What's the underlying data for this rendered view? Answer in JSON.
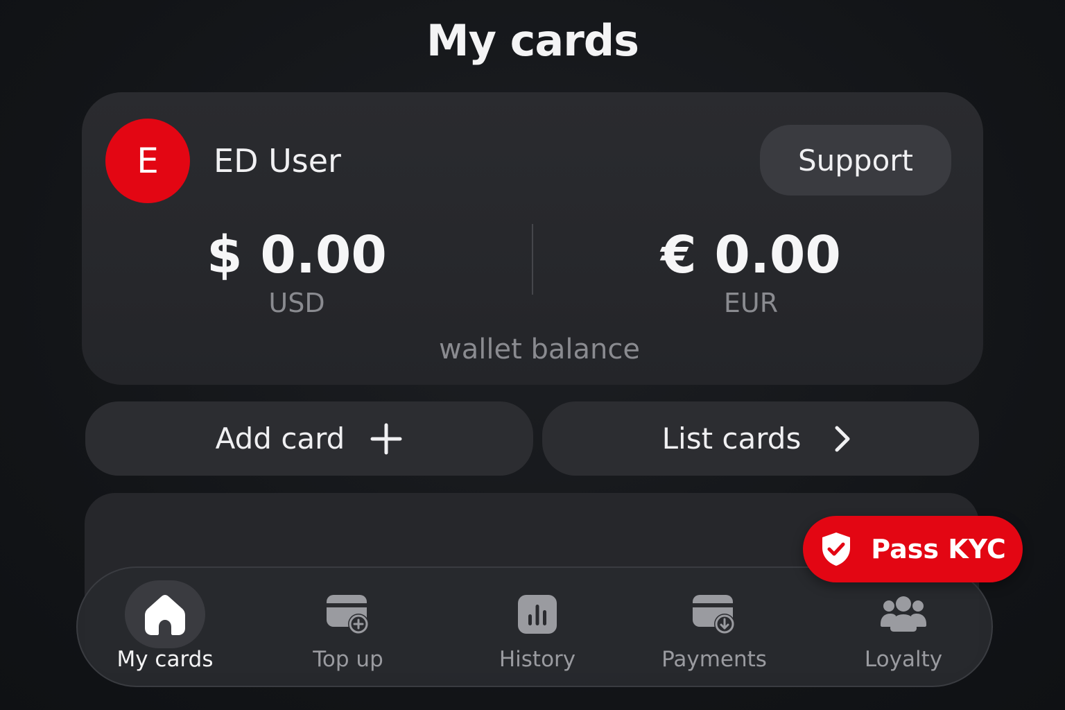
{
  "header": {
    "title": "My cards"
  },
  "profile": {
    "avatar_letter": "E",
    "name": "ED User"
  },
  "support": {
    "label": "Support"
  },
  "balance": {
    "usd": {
      "amount": "$ 0.00",
      "currency": "USD"
    },
    "eur": {
      "amount": "€ 0.00",
      "currency": "EUR"
    },
    "caption": "wallet balance"
  },
  "actions": {
    "add_card": {
      "label": "Add card",
      "icon": "plus-icon"
    },
    "list_cards": {
      "label": "List cards",
      "icon": "chevron-right-icon"
    }
  },
  "kyc": {
    "label": "Pass KYC",
    "icon": "shield-check-icon"
  },
  "nav": {
    "items": [
      {
        "label": "My cards",
        "icon": "home-icon",
        "active": true
      },
      {
        "label": "Top up",
        "icon": "card-plus-icon",
        "active": false
      },
      {
        "label": "History",
        "icon": "bar-chart-icon",
        "active": false
      },
      {
        "label": "Payments",
        "icon": "card-download-icon",
        "active": false
      },
      {
        "label": "Loyalty",
        "icon": "users-icon",
        "active": false
      }
    ]
  },
  "colors": {
    "accent": "#e30613",
    "card_bg": "#2a2b2f",
    "page_bg": "#141619",
    "muted_text": "#8a8b90"
  }
}
